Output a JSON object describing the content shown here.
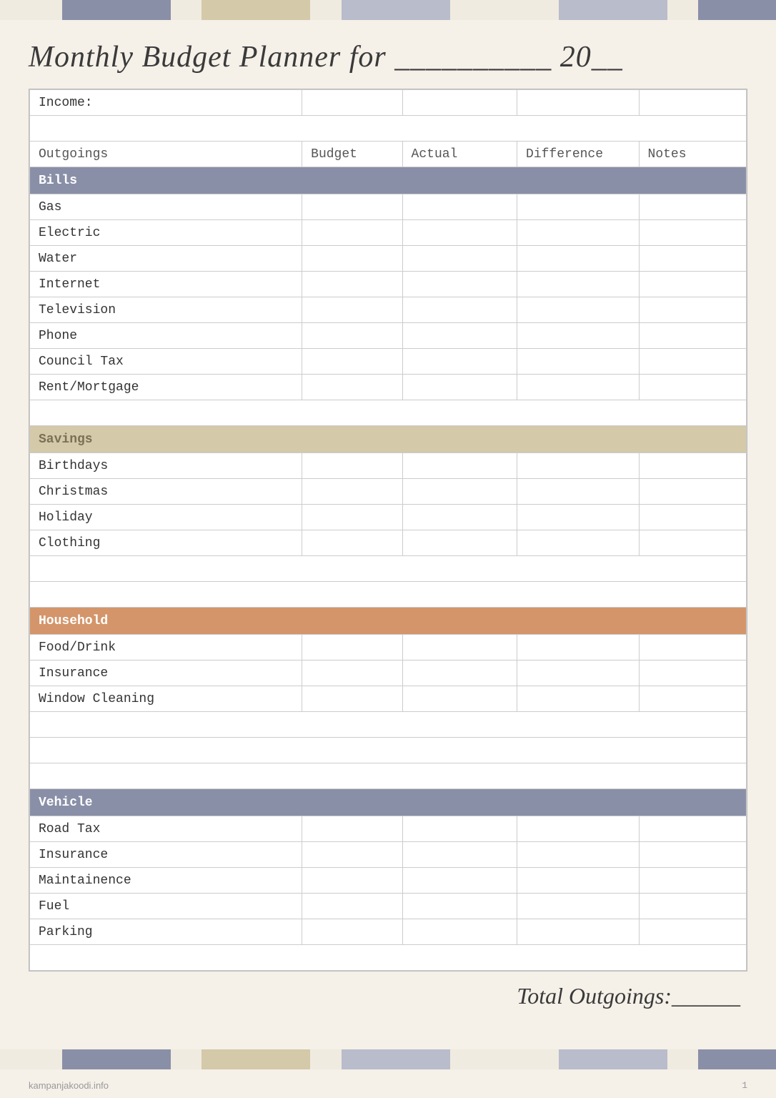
{
  "page": {
    "title": "Monthly Budget Planner for __________ 20__",
    "watermark": "kampanjakoodi.info",
    "page_number": "1"
  },
  "top_bar_segments": [
    {
      "color": "#e8e0cc",
      "width": "8%"
    },
    {
      "color": "#8a8fa8",
      "width": "14%"
    },
    {
      "color": "#e8e0cc",
      "width": "4%"
    },
    {
      "color": "#d4c9a8",
      "width": "14%"
    },
    {
      "color": "#e8e0cc",
      "width": "4%"
    },
    {
      "color": "#c8ccd8",
      "width": "14%"
    },
    {
      "color": "#e8e0cc",
      "width": "14%"
    },
    {
      "color": "#c8ccd8",
      "width": "14%"
    },
    {
      "color": "#e8e0cc",
      "width": "4%"
    },
    {
      "color": "#8a8fa8",
      "width": "10%"
    }
  ],
  "income_label": "Income:",
  "columns": {
    "outgoings": "Outgoings",
    "budget": "Budget",
    "actual": "Actual",
    "difference": "Difference",
    "notes": "Notes"
  },
  "sections": [
    {
      "name": "Bills",
      "type": "bills",
      "items": [
        "Gas",
        "Electric",
        "Water",
        "Internet",
        "Television",
        "Phone",
        "Council Tax",
        "Rent/Mortgage"
      ]
    },
    {
      "name": "Savings",
      "type": "savings",
      "items": [
        "Birthdays",
        "Christmas",
        "Holiday",
        "Clothing"
      ]
    },
    {
      "name": "Household",
      "type": "household",
      "items": [
        "Food/Drink",
        "Insurance",
        "Window Cleaning"
      ]
    },
    {
      "name": "Vehicle",
      "type": "vehicle",
      "items": [
        "Road Tax",
        "Insurance",
        "Maintainence",
        "Fuel",
        "Parking"
      ]
    }
  ],
  "total_label": "Total Outgoings:______"
}
